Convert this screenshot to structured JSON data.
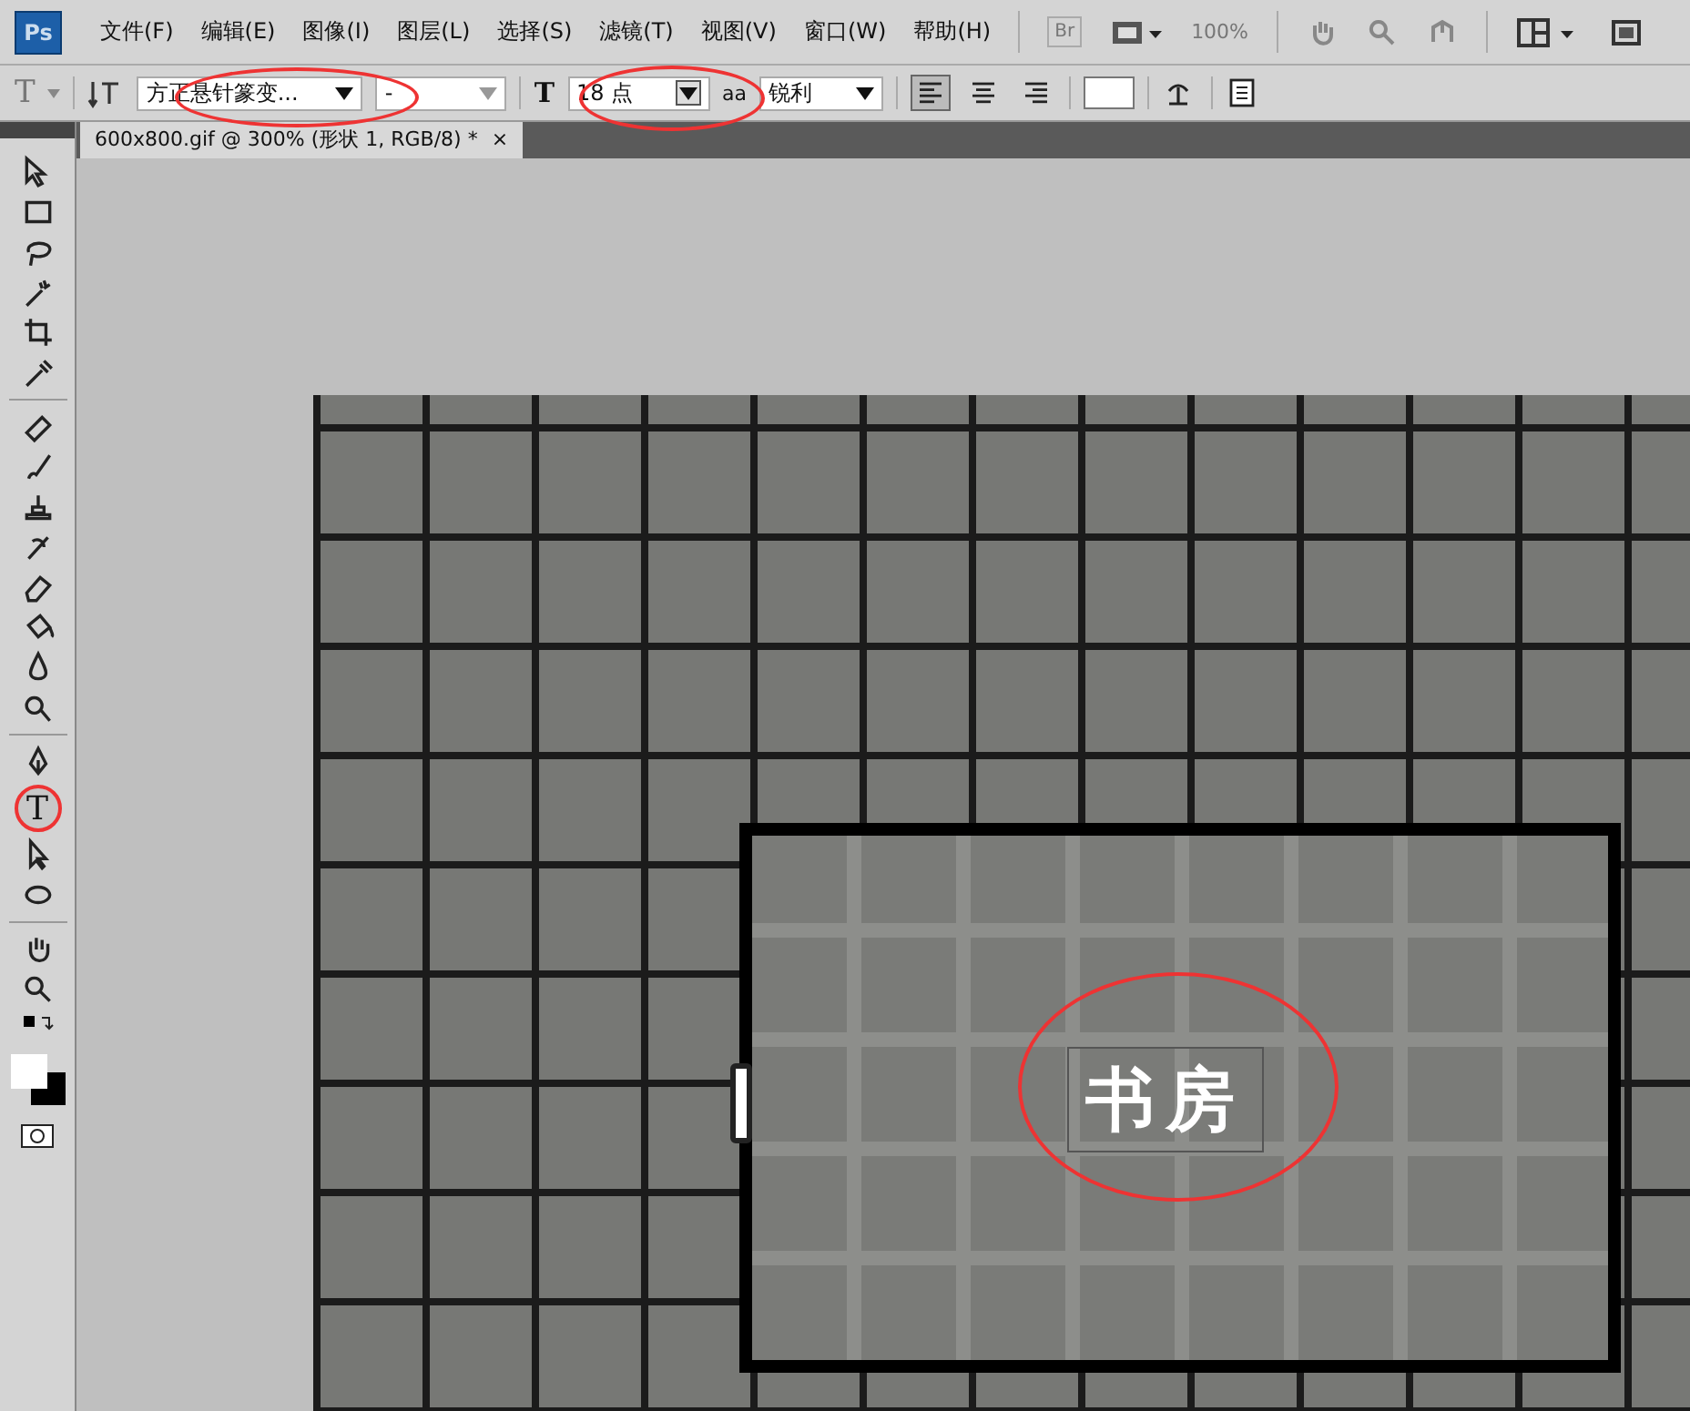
{
  "app": {
    "logo": "Ps"
  },
  "menu": [
    "文件(F)",
    "编辑(E)",
    "图像(I)",
    "图层(L)",
    "选择(S)",
    "滤镜(T)",
    "视图(V)",
    "窗口(W)",
    "帮助(H)"
  ],
  "app_bar": {
    "bridge": "Br",
    "zoom": "100%",
    "zoom_disabled": true
  },
  "options": {
    "tool_glyph": "T",
    "font_family": "方正悬针篆变...",
    "font_style": "-",
    "size_glyph": "T",
    "font_size": "18 点",
    "aa_glyph": "aa",
    "antialias": "锐利",
    "align": [
      {
        "kind": "left",
        "selected": true
      },
      {
        "kind": "center",
        "selected": false
      },
      {
        "kind": "right",
        "selected": false
      }
    ]
  },
  "document_tab": {
    "title": "600x800.gif @ 300% (形状 1, RGB/8) *",
    "close": "×"
  },
  "tools": [
    {
      "kind": "move",
      "selected": false
    },
    {
      "kind": "marquee",
      "selected": false
    },
    {
      "kind": "lasso",
      "selected": false
    },
    {
      "kind": "wand",
      "selected": false
    },
    {
      "kind": "crop",
      "selected": false
    },
    {
      "kind": "eyedropper",
      "selected": false
    },
    {
      "kind": "sep"
    },
    {
      "kind": "heal",
      "selected": false
    },
    {
      "kind": "brush",
      "selected": false
    },
    {
      "kind": "stamp",
      "selected": false
    },
    {
      "kind": "history",
      "selected": false
    },
    {
      "kind": "eraser",
      "selected": false
    },
    {
      "kind": "bucket",
      "selected": false
    },
    {
      "kind": "blur",
      "selected": false
    },
    {
      "kind": "dodge",
      "selected": false
    },
    {
      "kind": "sep"
    },
    {
      "kind": "pen",
      "selected": false
    },
    {
      "kind": "type",
      "selected": true,
      "glyph": "T"
    },
    {
      "kind": "select",
      "selected": false
    },
    {
      "kind": "ellipse",
      "selected": false
    },
    {
      "kind": "sep"
    },
    {
      "kind": "hand",
      "selected": false
    },
    {
      "kind": "zoom",
      "selected": false
    }
  ],
  "canvas": {
    "text": "书房"
  }
}
